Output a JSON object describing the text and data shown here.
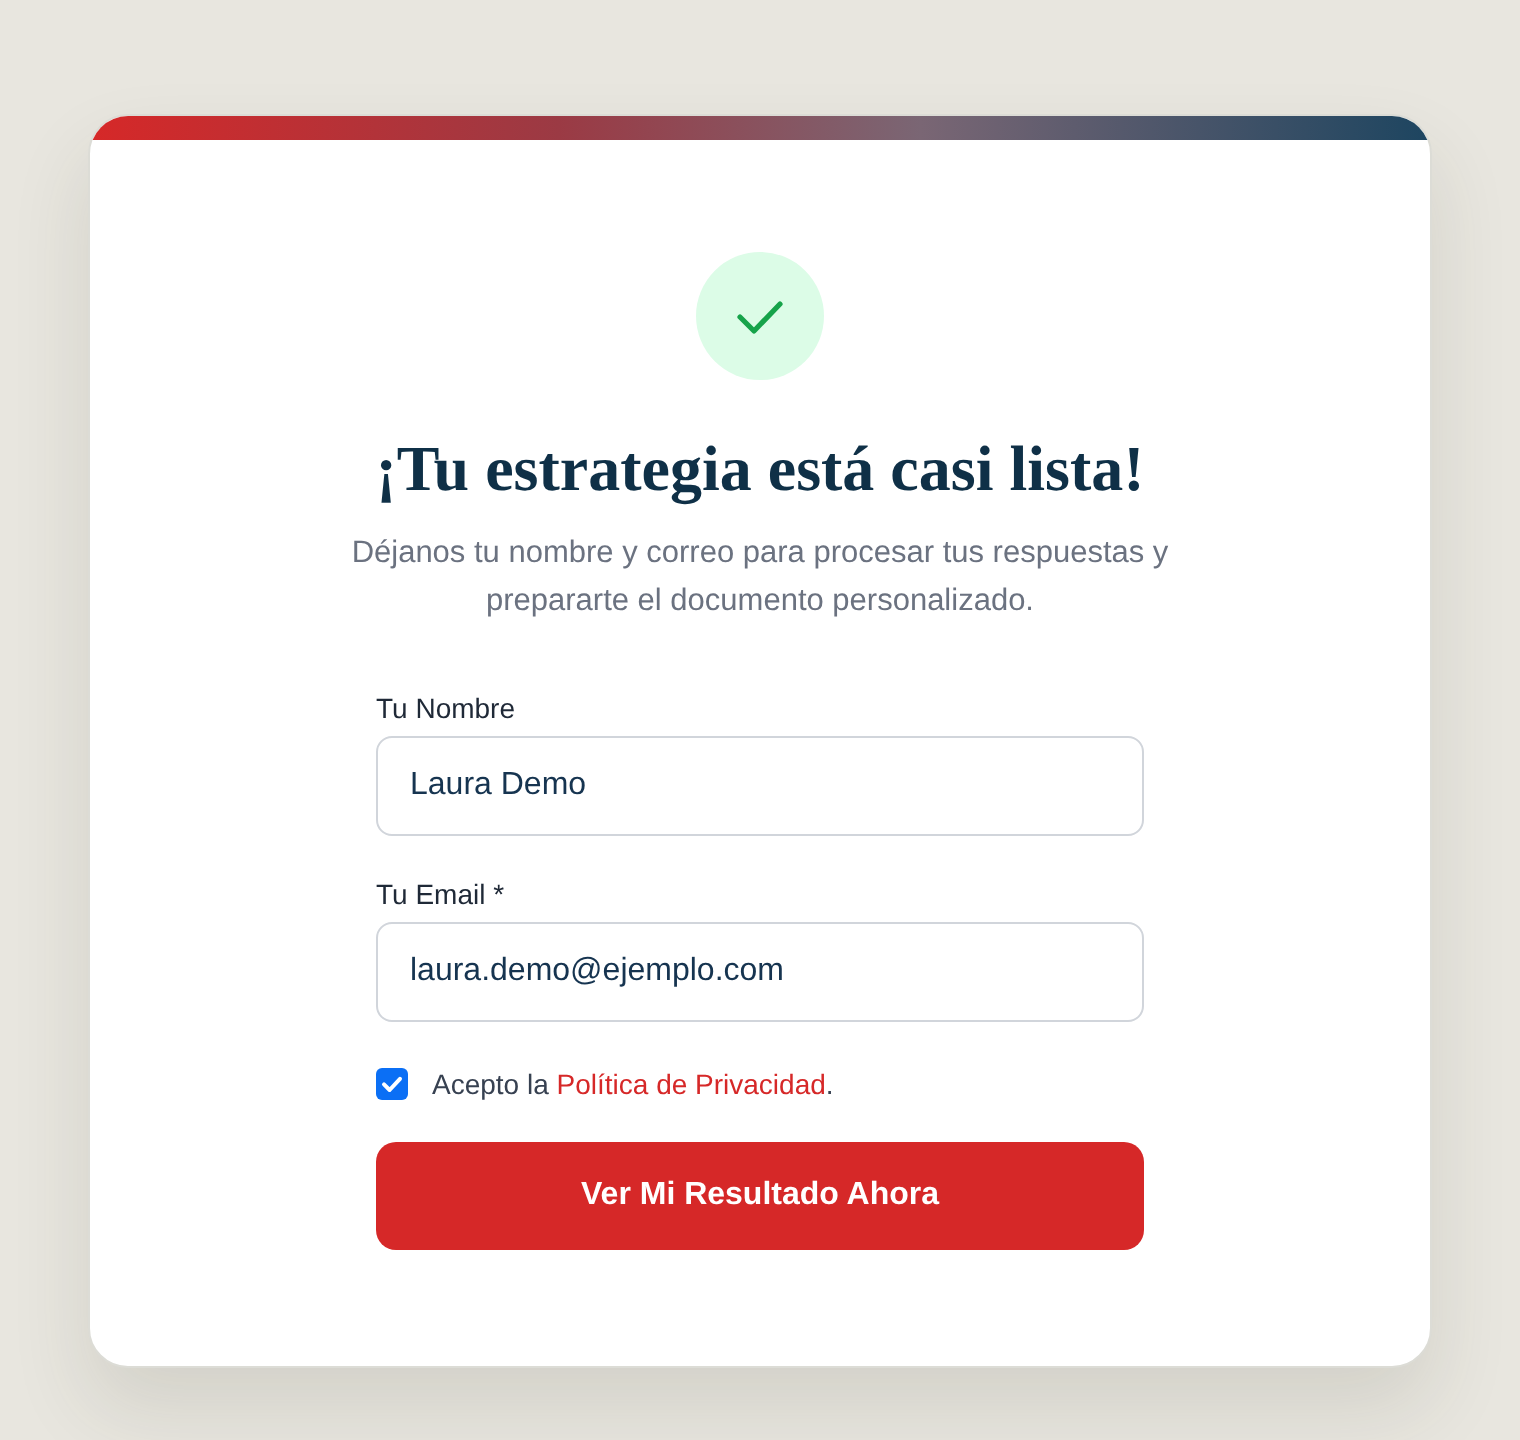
{
  "header": {
    "title": "¡Tu estrategia está casi lista!",
    "subtitle": "Déjanos tu nombre y correo para procesar tus respuestas y prepararte el documento personalizado."
  },
  "fields": [
    {
      "label": "Tu Nombre",
      "value": "Laura Demo"
    },
    {
      "label": "Tu Email *",
      "value": "laura.demo@ejemplo.com"
    }
  ],
  "consent": {
    "checked": true,
    "text": "Acepto la",
    "link": "Política de Privacidad",
    "suffix": "."
  },
  "submit_button": {
    "label": "Ver Mi Resultado Ahora"
  }
}
